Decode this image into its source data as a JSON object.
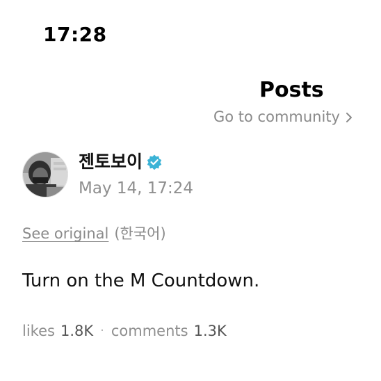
{
  "status_bar": {
    "time": "17:28"
  },
  "header": {
    "title": "Posts",
    "community_link": "Go to community",
    "community_link_icon": "chevron-right-icon"
  },
  "post": {
    "author": "젠토보이",
    "verified_icon": "verified-badge-icon",
    "verified_color": "#3bb3d6",
    "timestamp": "May 14, 17:24",
    "see_original": "See original",
    "original_language": "(한국어)",
    "body": "Turn on the M Countdown.",
    "likes_label": "likes",
    "likes_count": "1.8K",
    "separator": "·",
    "comments_label": "comments",
    "comments_count": "1.3K"
  }
}
